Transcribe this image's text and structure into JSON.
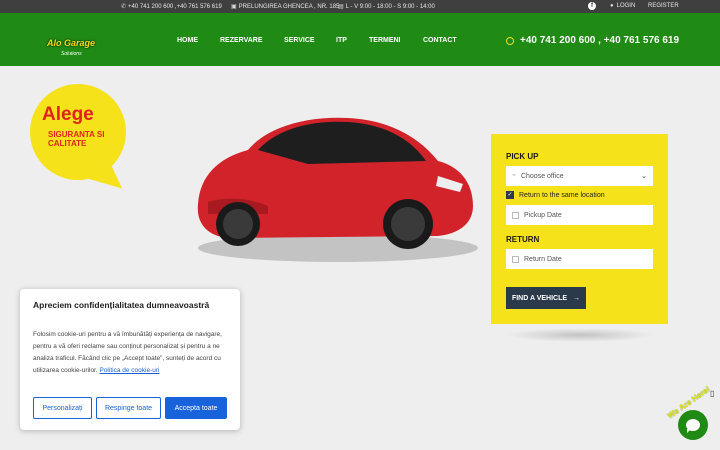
{
  "topbar": {
    "phones": "+40 741 200 600 ,+40 761 576 619",
    "address": "PRELUNGIREA GHENCEA , NR. 185",
    "hours": "L - V 9:00 - 18:00 - S 9:00 - 14:00",
    "login": "LOGIN",
    "register": "REGISTER"
  },
  "header": {
    "logo_brand": "Alo Garage",
    "logo_sub": "Solutions",
    "nav": [
      "HOME",
      "REZERVARE",
      "SERVICE",
      "ITP",
      "TERMENI",
      "CONTACT"
    ],
    "phone": "+40 741 200 600 , +40 761 576 619"
  },
  "hero": {
    "bubble_big": "Alege",
    "bubble_small": "SIGURANTA SI CALITATE",
    "car_color": "#d3232a"
  },
  "form": {
    "pickup_label": "PICK UP",
    "office_placeholder": "Choose office",
    "return_same": "Return to the same location",
    "pickup_date": "Pickup Date",
    "return_label": "RETURN",
    "return_date": "Return Date",
    "find_button": "FIND A VEHICLE"
  },
  "cookie": {
    "title": "Apreciem confidențialitatea dumneavoastră",
    "text": "Folosim cookie-uri pentru a vă îmbunătăți experiența de navigare, pentru a vă oferi reclame sau conținut personalizat și pentru a ne analiza traficul. Făcând clic pe „Accept toate”, sunteți de acord cu utilizarea cookie-urilor.",
    "policy_link": "Politica de cookie-uri",
    "btn_customize": "Personalizați",
    "btn_reject": "Respinge toate",
    "btn_accept": "Accepta toate"
  },
  "chat": {
    "label": "We Are Here!"
  },
  "colors": {
    "green": "#1f8a14",
    "yellow": "#f5e21b",
    "dark": "#2b3a4a",
    "cookie_blue": "#1863dc"
  }
}
